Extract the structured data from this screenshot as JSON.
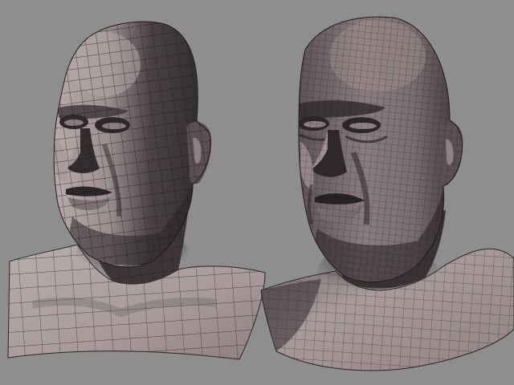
{
  "scene": {
    "background_color": "#8e8e8e",
    "skin_light": "#b6a8a8",
    "skin_mid": "#8f8182",
    "skin_dark": "#3b3437",
    "wire_color": "#1c1a1c",
    "models": [
      {
        "id": "low-poly-head",
        "mesh_density": "low"
      },
      {
        "id": "high-poly-head",
        "mesh_density": "high"
      }
    ]
  }
}
